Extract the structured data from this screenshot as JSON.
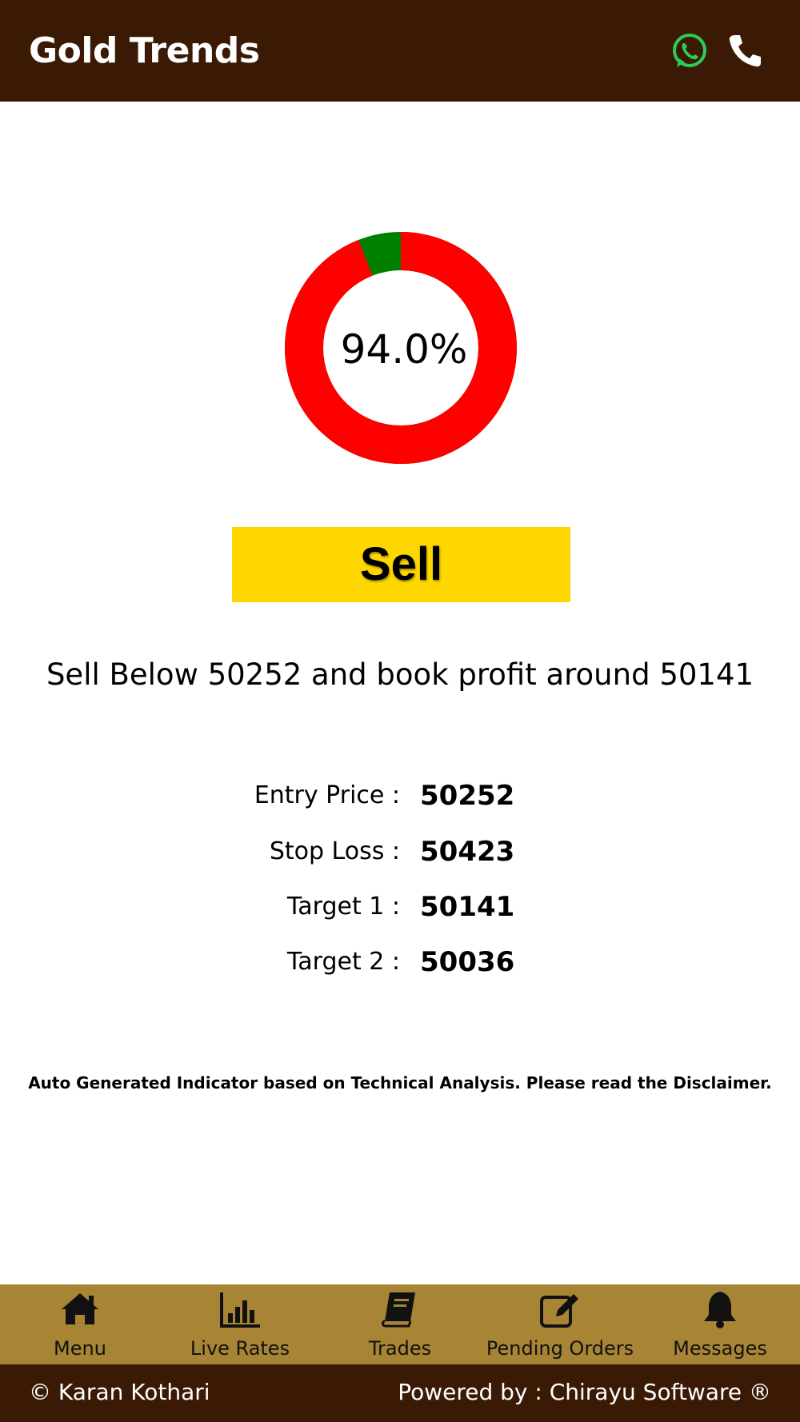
{
  "header": {
    "title": "Gold Trends",
    "whatsapp_icon": "whatsapp-icon",
    "phone_icon": "phone-icon"
  },
  "gauge": {
    "percent": 94.0,
    "label": "94.0%",
    "colors": {
      "main": "#ff0000",
      "rest": "#008000"
    }
  },
  "signal": {
    "label": "Sell",
    "color": "#ffd700"
  },
  "advice": "Sell Below 50252 and book profit around 50141",
  "levels": [
    {
      "key": "Entry Price :",
      "value": "50252"
    },
    {
      "key": "Stop Loss :",
      "value": "50423"
    },
    {
      "key": "Target 1 :",
      "value": "50141"
    },
    {
      "key": "Target 2 :",
      "value": "50036"
    }
  ],
  "disclaimer": "Auto Generated Indicator based on Technical Analysis. Please read the Disclaimer.",
  "nav": {
    "items": [
      {
        "label": "Menu",
        "icon": "home-icon"
      },
      {
        "label": "Live Rates",
        "icon": "bar-chart-icon"
      },
      {
        "label": "Trades",
        "icon": "book-icon"
      },
      {
        "label": "Pending Orders",
        "icon": "edit-icon"
      },
      {
        "label": "Messages",
        "icon": "bell-icon"
      }
    ]
  },
  "footer": {
    "left": "© Karan Kothari",
    "right": "Powered by : Chirayu Software ®"
  },
  "colors": {
    "header_bg": "#3b1a05",
    "nav_bg": "#a88535"
  }
}
